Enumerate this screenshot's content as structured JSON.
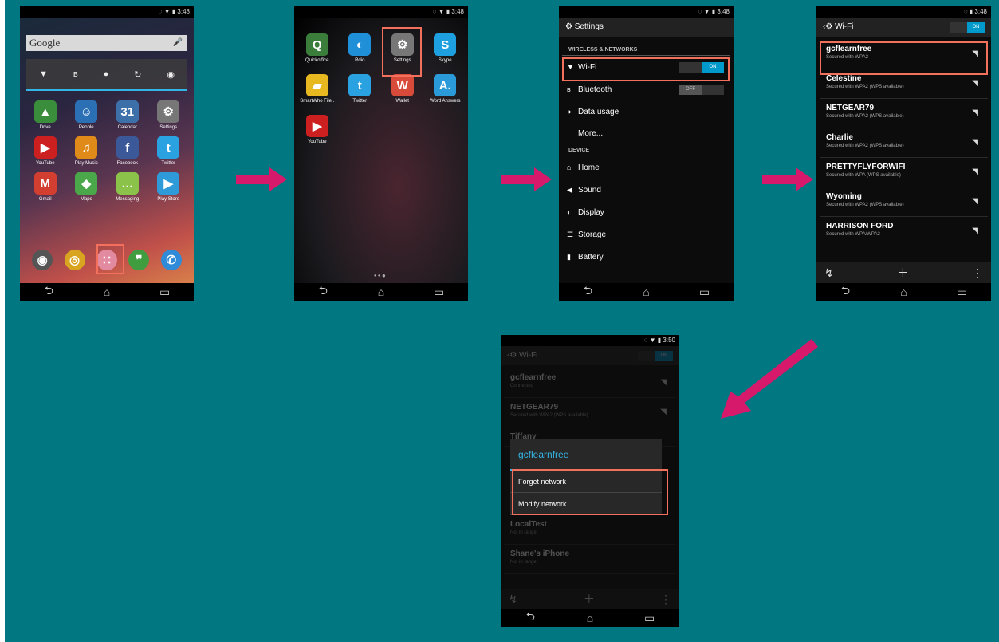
{
  "screen1": {
    "time": "3:48",
    "search_label": "Google",
    "apps": [
      {
        "label": "Drive",
        "color": "#3a8d3a",
        "glyph": "▲"
      },
      {
        "label": "People",
        "color": "#2b6fb5",
        "glyph": "☺"
      },
      {
        "label": "Calendar",
        "color": "#3d6fa8",
        "glyph": "31"
      },
      {
        "label": "Settings",
        "color": "#777777",
        "glyph": "⚙"
      },
      {
        "label": "YouTube",
        "color": "#cc2020",
        "glyph": "▶"
      },
      {
        "label": "Play Music",
        "color": "#e08a1a",
        "glyph": "♫"
      },
      {
        "label": "Facebook",
        "color": "#3b5998",
        "glyph": "f"
      },
      {
        "label": "Twitter",
        "color": "#2aa1e0",
        "glyph": "t"
      },
      {
        "label": "Gmail",
        "color": "#d23f31",
        "glyph": "M"
      },
      {
        "label": "Maps",
        "color": "#4aa84a",
        "glyph": "◆"
      },
      {
        "label": "Messaging",
        "color": "#8bc34a",
        "glyph": "…"
      },
      {
        "label": "Play Store",
        "color": "#2f9ad8",
        "glyph": "▶"
      }
    ],
    "dock": [
      {
        "name": "camera",
        "color": "#555555",
        "glyph": "◉"
      },
      {
        "name": "chrome",
        "color": "#d9a520",
        "glyph": "◎"
      },
      {
        "name": "app-drawer",
        "color": "#e28aa0",
        "glyph": "∷"
      },
      {
        "name": "hangouts",
        "color": "#3f9d3f",
        "glyph": "❞"
      },
      {
        "name": "phone",
        "color": "#2f8ad8",
        "glyph": "✆"
      }
    ]
  },
  "screen2": {
    "time": "3:48",
    "apps": [
      {
        "label": "Quickoffice",
        "color": "#3b7d3b",
        "glyph": "Q"
      },
      {
        "label": "Rdio",
        "color": "#1f8fd8",
        "glyph": "◐"
      },
      {
        "label": "Settings",
        "color": "#777777",
        "glyph": "⚙"
      },
      {
        "label": "Skype",
        "color": "#1ea0e0",
        "glyph": "S"
      },
      {
        "label": "SmartWho File..",
        "color": "#e8b820",
        "glyph": "▰"
      },
      {
        "label": "Twitter",
        "color": "#2aa1e0",
        "glyph": "t"
      },
      {
        "label": "Wallet",
        "color": "#d84a3a",
        "glyph": "W"
      },
      {
        "label": "Word Answers",
        "color": "#2a9ad8",
        "glyph": "A."
      },
      {
        "label": "YouTube",
        "color": "#cc2020",
        "glyph": "▶"
      }
    ]
  },
  "screen3": {
    "time": "3:48",
    "title": "Settings",
    "section1": "WIRELESS & NETWORKS",
    "wifi_label": "Wi-Fi",
    "wifi_state": "ON",
    "bluetooth_label": "Bluetooth",
    "bluetooth_state": "OFF",
    "data_usage": "Data usage",
    "more": "More...",
    "section2": "DEVICE",
    "device_items": [
      "Home",
      "Sound",
      "Display",
      "Storage",
      "Battery"
    ]
  },
  "screen4": {
    "time": "3:48",
    "title": "Wi-Fi",
    "state": "ON",
    "networks": [
      {
        "name": "gcflearnfree",
        "sub": "Secured with WPA2"
      },
      {
        "name": "Celestine",
        "sub": "Secured with WPA2 (WPS available)"
      },
      {
        "name": "NETGEAR79",
        "sub": "Secured with WPA2 (WPS available)"
      },
      {
        "name": "Charlie",
        "sub": "Secured with WPA2 (WPS available)"
      },
      {
        "name": "PRETTYFLYFORWIFI",
        "sub": "Secured with WPA (WPS available)"
      },
      {
        "name": "Wyoming",
        "sub": "Secured with WPA2 (WPS available)"
      },
      {
        "name": "HARRISON FORD",
        "sub": "Secured with WPA/WPA2"
      }
    ]
  },
  "screen5": {
    "time": "3:50",
    "title": "Wi-Fi",
    "state": "ON",
    "networks_top": [
      {
        "name": "gcflearnfree",
        "sub": "Connected"
      },
      {
        "name": "NETGEAR79",
        "sub": "Secured with WPA2 (WPS available)"
      }
    ],
    "partial": "Tiffany",
    "dialog_title": "gcflearnfree",
    "forget": "Forget network",
    "modify": "Modify network",
    "networks_bottom": [
      {
        "name": "LocalTest",
        "sub": "Not in range"
      },
      {
        "name": "Shane's iPhone",
        "sub": "Not in range"
      }
    ]
  },
  "colors": {
    "background": "#017782",
    "arrow": "#d6196a",
    "highlight": "#f2705c",
    "accent": "#33b5e5"
  }
}
